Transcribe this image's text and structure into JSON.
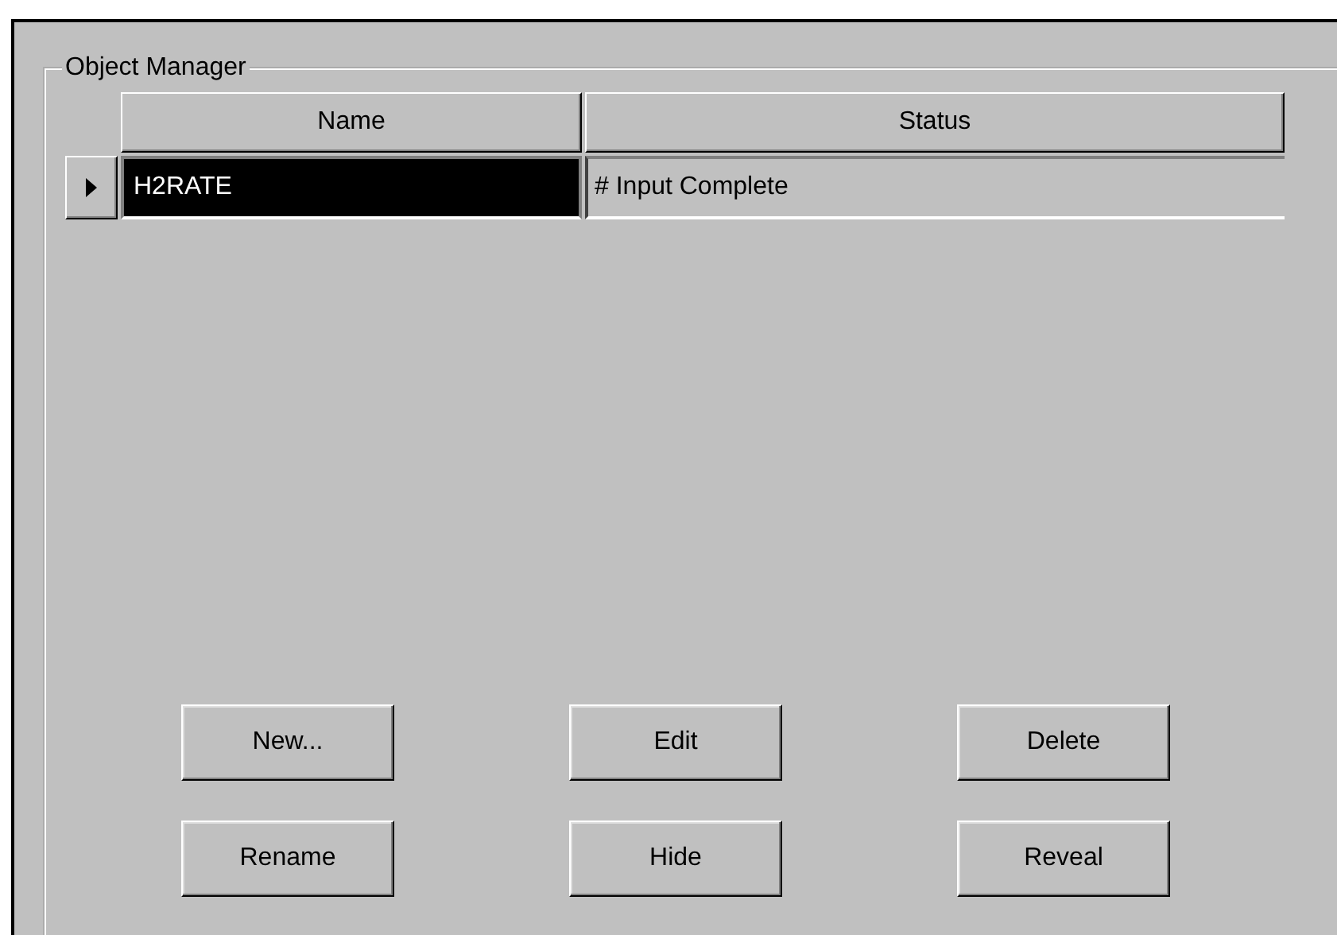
{
  "group": {
    "title": "Object Manager"
  },
  "table": {
    "columns": [
      "Name",
      "Status"
    ],
    "rows": [
      {
        "name": "H2RATE",
        "status": "# Input Complete",
        "selected": true
      }
    ]
  },
  "buttons": [
    "New...",
    "Edit",
    "Delete",
    "Rename",
    "Hide",
    "Reveal"
  ]
}
